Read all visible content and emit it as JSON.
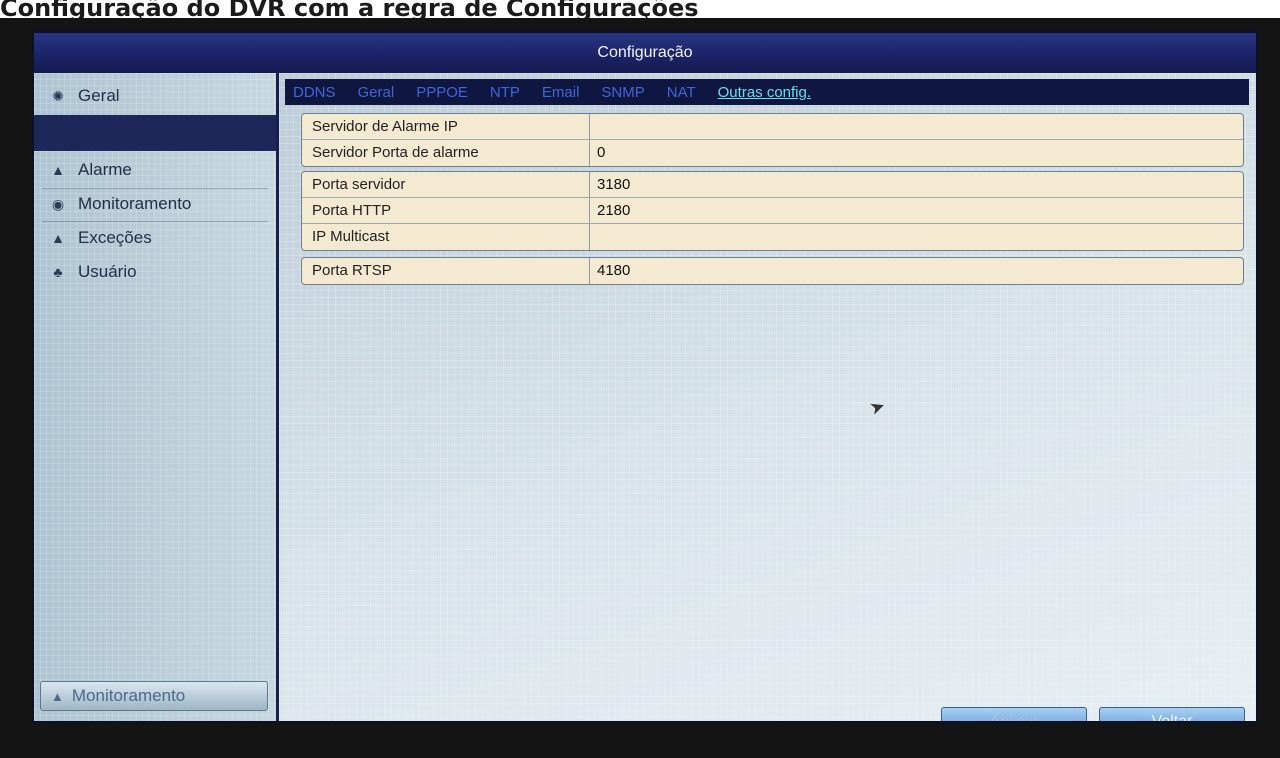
{
  "photo_caption": "Configuração do DVR com a regra de Configurações",
  "window": {
    "title": "Configuração"
  },
  "sidebar": {
    "items": [
      {
        "label": "Geral",
        "icon": "gear-icon"
      },
      {
        "label": "Alarme",
        "icon": "bell-icon"
      },
      {
        "label": "Monitoramento",
        "icon": "eye-icon"
      },
      {
        "label": "Exceções",
        "icon": "warning-icon"
      },
      {
        "label": "Usuário",
        "icon": "users-icon"
      }
    ],
    "bottom_button": {
      "label": "Monitoramento",
      "icon": "home-icon"
    }
  },
  "tabs": [
    "DDNS",
    "Geral",
    "PPPOE",
    "NTP",
    "Email",
    "SNMP",
    "NAT",
    "Outras config."
  ],
  "active_tab": "Outras config.",
  "settings": {
    "group1": [
      {
        "label": "Servidor de Alarme IP",
        "value": ""
      },
      {
        "label": "Servidor Porta de alarme",
        "value": "0"
      }
    ],
    "group2": [
      {
        "label": "Porta servidor",
        "value": "3180"
      },
      {
        "label": "Porta HTTP",
        "value": "2180"
      },
      {
        "label": "IP Multicast",
        "value": ""
      }
    ],
    "group3": [
      {
        "label": "Porta RTSP",
        "value": "4180"
      }
    ]
  },
  "buttons": {
    "apply": "Aplicar",
    "back": "Voltar"
  },
  "colors": {
    "titlebar": "#1c2467",
    "active_tab": "#66e0e8",
    "tab": "#3e67d8",
    "row_bg": "#f4ead2"
  }
}
